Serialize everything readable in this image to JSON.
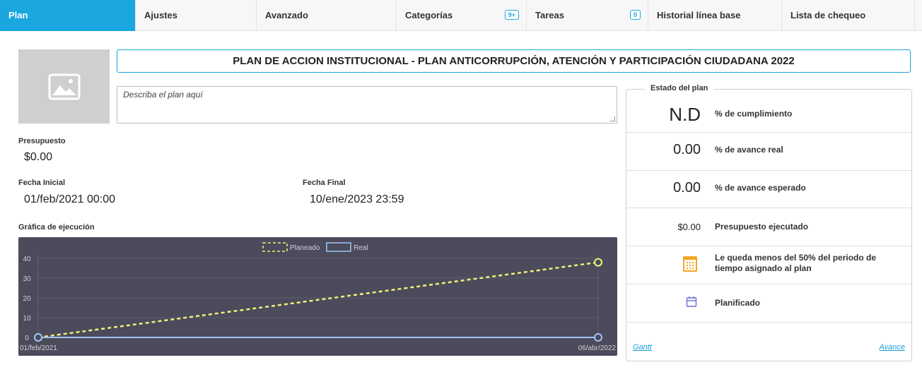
{
  "tabs": [
    {
      "label": "Plan",
      "active": true
    },
    {
      "label": "Ajustes"
    },
    {
      "label": "Avanzado"
    },
    {
      "label": "Categorías",
      "badge": "9+"
    },
    {
      "label": "Tareas",
      "badge": "0"
    },
    {
      "label": "Historial línea base"
    },
    {
      "label": "Lista de chequeo"
    }
  ],
  "plan": {
    "title": "PLAN DE ACCION INSTITUCIONAL - PLAN ANTICORRUPCIÓN, ATENCIÓN Y PARTICIPACIÓN CIUDADANA 2022",
    "description_placeholder": "Describa el plan aquí",
    "budget_label": "Presupuesto",
    "budget_value": "$0.00",
    "start_label": "Fecha Inicial",
    "start_value": "01/feb/2021 00:00",
    "end_label": "Fecha Final",
    "end_value": "10/ene/2023 23:59",
    "chart_label": "Gráfica de ejecución"
  },
  "status": {
    "title": "Estado del plan",
    "compliance_value": "N.D",
    "compliance_label": "% de cumplimiento",
    "real_value": "0.00",
    "real_label": "% de avance real",
    "expected_value": "0.00",
    "expected_label": "% de avance esperado",
    "budget_exec_value": "$0.00",
    "budget_exec_label": "Presupuesto ejecutado",
    "period_msg": "Le queda menos del 50% del periodo de tiempo asignado al plan",
    "state_label": "Planificado",
    "gantt_link": "Gantt",
    "avance_link": "Avance"
  },
  "colors": {
    "accent": "#1aa7e0",
    "chart_bg": "#4b4b5c",
    "planned": "#f0f07a",
    "real": "#9ec5f5",
    "calendar_orange": "#f5a623",
    "state_icon": "#6b6bd6"
  },
  "chart_data": {
    "type": "line",
    "x": [
      "01/feb/2021",
      "06/abr/2022"
    ],
    "series": [
      {
        "name": "Planeado",
        "values": [
          0,
          38
        ],
        "style": "dashed"
      },
      {
        "name": "Real",
        "values": [
          0,
          0
        ],
        "style": "solid"
      }
    ],
    "yticks": [
      0,
      10,
      20,
      30,
      40
    ],
    "ylim": [
      0,
      40
    ],
    "legend": "top"
  }
}
